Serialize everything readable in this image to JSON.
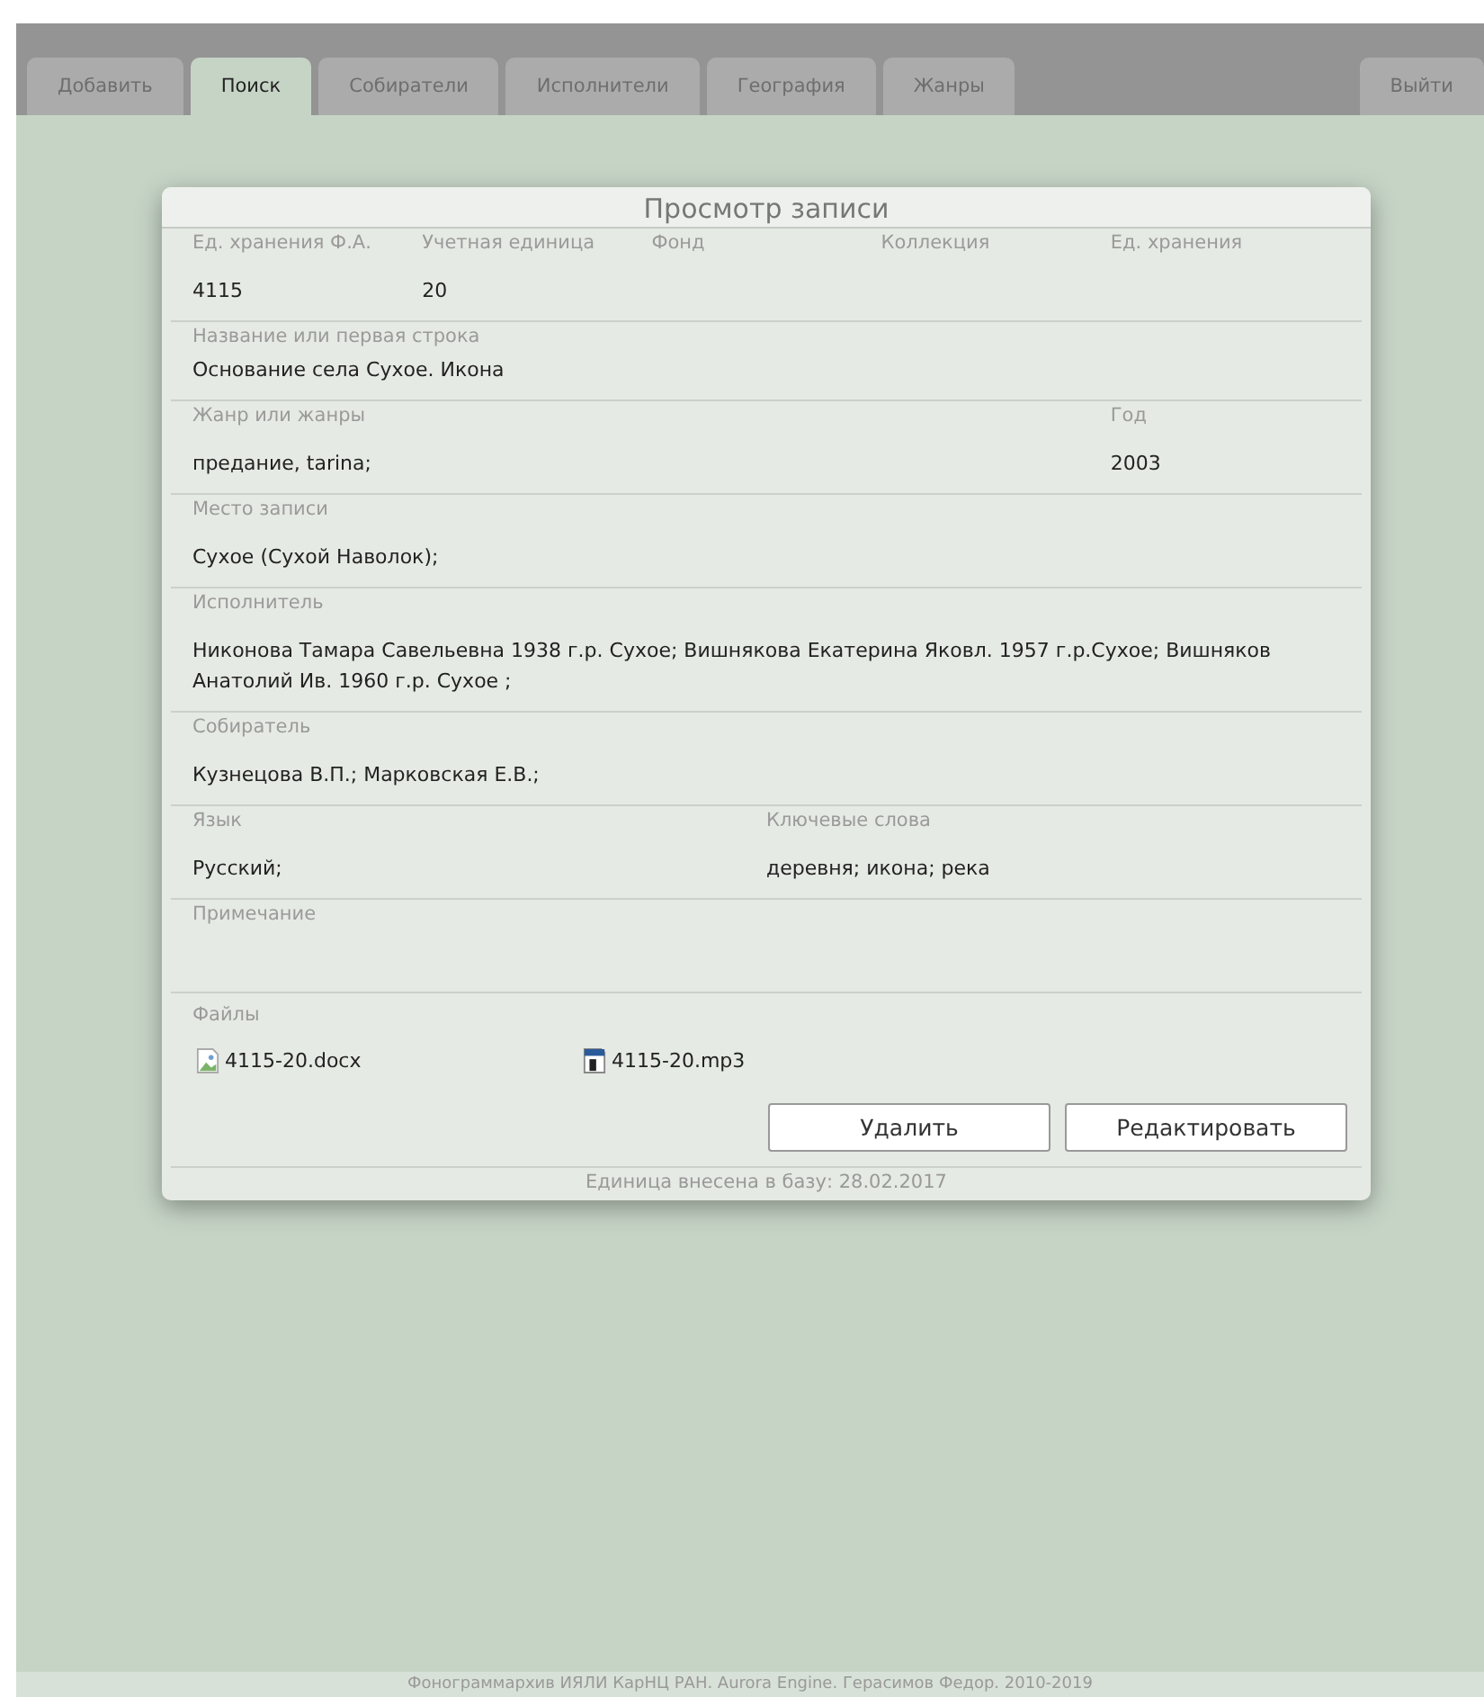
{
  "tabs": [
    {
      "label": "Добавить",
      "selected": false
    },
    {
      "label": "Поиск",
      "selected": true
    },
    {
      "label": "Собиратели",
      "selected": false
    },
    {
      "label": "Исполнители",
      "selected": false
    },
    {
      "label": "География",
      "selected": false
    },
    {
      "label": "Жанры",
      "selected": false
    }
  ],
  "logout": "Выйти",
  "dialog": {
    "title": "Просмотр записи",
    "rows": [
      {
        "kind": "five",
        "fields": [
          {
            "label": "Ед. хранения Ф.А.",
            "value": "4115"
          },
          {
            "label": "Учетная единица",
            "value": "20"
          },
          {
            "label": "Фонд"
          },
          {
            "label": "Коллекция"
          },
          {
            "label": "Ед. хранения"
          }
        ]
      },
      {
        "kind": "tight",
        "fields": [
          {
            "label": "Название или первая строка",
            "value": "Основание села Сухое. Икона"
          }
        ]
      },
      {
        "kind": "wide_narrow",
        "fields": [
          {
            "label": "Жанр или жанры",
            "value": "предание, tarina;"
          },
          {
            "label": "Год",
            "value": "2003"
          }
        ]
      },
      {
        "kind": "single",
        "fields": [
          {
            "label": "Место записи",
            "value": "Сухое (Сухой Наволок);"
          }
        ]
      },
      {
        "kind": "single",
        "fields": [
          {
            "label": "Исполнитель",
            "value": "Никонова Тамара Савельевна 1938 г.р. Сухое; Вишнякова Екатерина Яковл. 1957 г.р.Сухое; Вишняков Анатолий Ив. 1960 г.р. Сухое ;"
          }
        ]
      },
      {
        "kind": "single",
        "fields": [
          {
            "label": "Собиратель",
            "value": "Кузнецова В.П.; Марковская Е.В.;"
          }
        ]
      },
      {
        "kind": "halves",
        "fields": [
          {
            "label": "Язык",
            "value": "Русский;"
          },
          {
            "label": "Ключевые слова",
            "value": "деревня; икона; река"
          }
        ]
      },
      {
        "kind": "single",
        "fields": [
          {
            "label": "Примечание"
          }
        ]
      }
    ],
    "files_label": "Файлы",
    "files": [
      {
        "kind": "broken",
        "name": "4115-20.docx"
      },
      {
        "kind": "audio",
        "name": "4115-20.mp3"
      }
    ],
    "buttons": [
      "Удалить",
      "Редактировать"
    ],
    "note": "Единица внесена в базу: 28.02.2017"
  },
  "footer": "Фонограммархив ИЯЛИ КарНЦ РАН. Aurora Engine. Герасимов Федор. 2010-2019"
}
